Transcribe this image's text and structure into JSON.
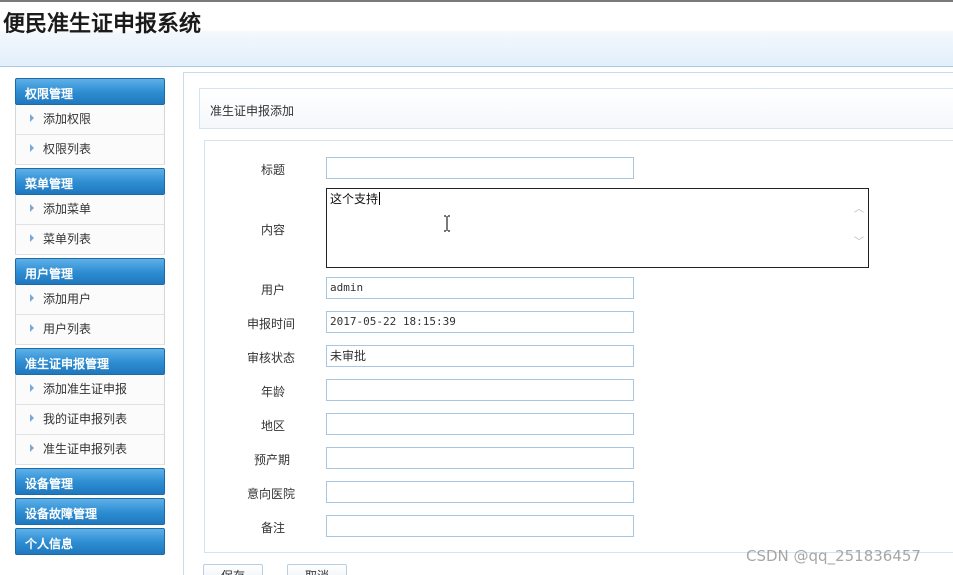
{
  "app": {
    "title": "便民准生证申报系统"
  },
  "sidebar": {
    "groups": [
      {
        "label": "权限管理",
        "items": [
          {
            "label": "添加权限"
          },
          {
            "label": "权限列表"
          }
        ]
      },
      {
        "label": "菜单管理",
        "items": [
          {
            "label": "添加菜单"
          },
          {
            "label": "菜单列表"
          }
        ]
      },
      {
        "label": "用户管理",
        "items": [
          {
            "label": "添加用户"
          },
          {
            "label": "用户列表"
          }
        ]
      },
      {
        "label": "准生证申报管理",
        "items": [
          {
            "label": "添加准生证申报"
          },
          {
            "label": "我的证申报列表"
          },
          {
            "label": "准生证申报列表"
          }
        ]
      },
      {
        "label": "设备管理"
      },
      {
        "label": "设备故障管理"
      },
      {
        "label": "个人信息"
      }
    ]
  },
  "breadcrumb": {
    "text": "准生证申报添加"
  },
  "form": {
    "title": {
      "label": "标题",
      "value": ""
    },
    "content": {
      "label": "内容",
      "value": "这个支持"
    },
    "user": {
      "label": "用户",
      "value": "admin"
    },
    "apply_time": {
      "label": "申报时间",
      "value": "2017-05-22 18:15:39"
    },
    "review_status": {
      "label": "审核状态",
      "value": "未审批"
    },
    "age": {
      "label": "年龄",
      "value": ""
    },
    "region": {
      "label": "地区",
      "value": ""
    },
    "due_date": {
      "label": "预产期",
      "value": ""
    },
    "hospital": {
      "label": "意向医院",
      "value": ""
    },
    "remark": {
      "label": "备注",
      "value": ""
    }
  },
  "buttons": {
    "save": "保存",
    "cancel": "取消"
  },
  "watermark": "CSDN @qq_251836457"
}
